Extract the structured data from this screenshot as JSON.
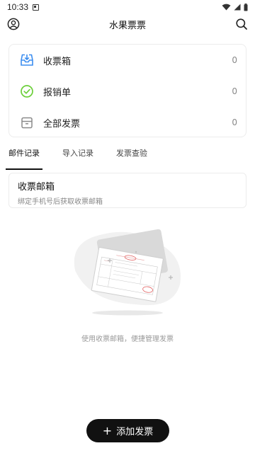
{
  "status_bar": {
    "time": "10:33"
  },
  "app_bar": {
    "title": "水果票票"
  },
  "summary": {
    "items": [
      {
        "label": "收票箱",
        "count": "0",
        "icon": "inbox-icon"
      },
      {
        "label": "报销单",
        "count": "0",
        "icon": "check-circle-icon"
      },
      {
        "label": "全部发票",
        "count": "0",
        "icon": "archive-box-icon"
      }
    ]
  },
  "tabs": [
    {
      "label": "邮件记录",
      "active": true
    },
    {
      "label": "导入记录",
      "active": false
    },
    {
      "label": "发票查验",
      "active": false
    }
  ],
  "mailbox": {
    "title": "收票邮箱",
    "subtitle": "绑定手机号后获取收票邮箱"
  },
  "empty_state": {
    "text": "使用收票邮箱，便捷管理发票"
  },
  "add_button": {
    "label": "添加发票"
  },
  "colors": {
    "accent_blue": "#3b8df0",
    "accent_green": "#6ccf3a",
    "button_dark": "#111111"
  }
}
